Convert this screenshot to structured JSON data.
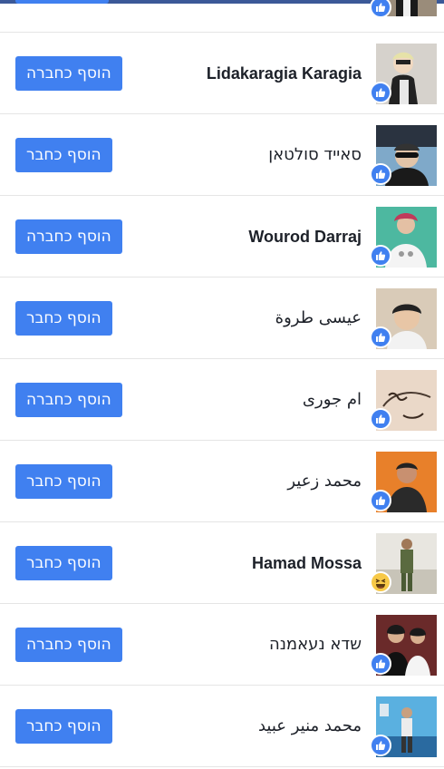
{
  "people": [
    {
      "name": "",
      "button_label": "",
      "reaction": "like-icon",
      "partial": true
    },
    {
      "name": "Lidakaragia Karagia",
      "button_label": "הוסף כחברה",
      "reaction": "like-icon"
    },
    {
      "name": "סאייד סולטאן",
      "button_label": "הוסף כחבר",
      "reaction": "like-icon"
    },
    {
      "name": "Wourod Darraj",
      "button_label": "הוסף כחברה",
      "reaction": "like-icon"
    },
    {
      "name": "عيسى طروة",
      "button_label": "הוסף כחבר",
      "reaction": "like-icon"
    },
    {
      "name": "ام جورى",
      "button_label": "הוסף כחברה",
      "reaction": "like-icon"
    },
    {
      "name": "محمد زعير",
      "button_label": "הוסף כחבר",
      "reaction": "like-icon"
    },
    {
      "name": "Hamad Mossa",
      "button_label": "הוסף כחבר",
      "reaction": "haha-icon"
    },
    {
      "name": "שדא נעאמנה",
      "button_label": "הוסף כחברה",
      "reaction": "like-icon"
    },
    {
      "name": "محمد منير عبيد",
      "button_label": "הוסף כחבר",
      "reaction": "like-icon"
    }
  ],
  "colors": {
    "button": "#4080f0",
    "like_badge": "#4080f0",
    "haha_badge": "#f7c948",
    "topbar": "#3b5998"
  }
}
